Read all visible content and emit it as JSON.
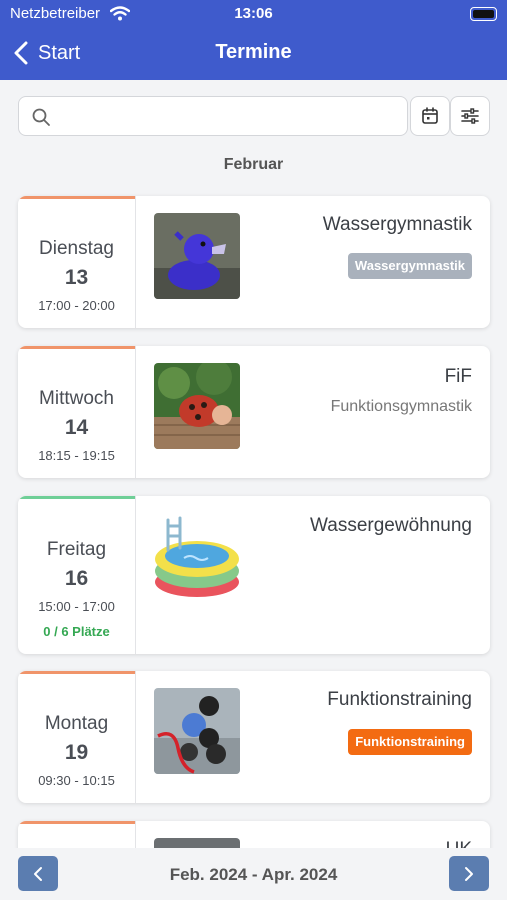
{
  "status_bar": {
    "carrier": "Netzbetreiber",
    "time": "13:06"
  },
  "nav": {
    "back_label": "Start",
    "title": "Termine"
  },
  "search": {
    "placeholder": "",
    "value": ""
  },
  "month_header": "Februar",
  "appointments": [
    {
      "weekday": "Dienstag",
      "day": "13",
      "time": "17:00 - 20:00",
      "title": "Wassergymnastik",
      "badge": "Wassergymnastik",
      "badge_color": "#a9b1bc",
      "accent": "#f0946a",
      "image": "purple-rubber-duck"
    },
    {
      "weekday": "Mittwoch",
      "day": "14",
      "time": "18:15 - 19:15",
      "title": "FiF",
      "subtitle": "Funktionsgymnastik",
      "accent": "#f0946a",
      "image": "ladybug-figure"
    },
    {
      "weekday": "Freitag",
      "day": "16",
      "time": "15:00 - 17:00",
      "slots": "0 / 6 Plätze",
      "title": "Wassergewöhnung",
      "accent": "#6fcf97",
      "image": "paddling-pool"
    },
    {
      "weekday": "Montag",
      "day": "19",
      "time": "09:30 - 10:15",
      "title": "Funktionstraining",
      "badge": "Funktionstraining",
      "badge_color": "#f36b12",
      "accent": "#f0946a",
      "image": "kettlebells"
    },
    {
      "title": "UK",
      "accent": "#f0946a"
    }
  ],
  "pagination": {
    "range": "Feb. 2024 - Apr. 2024"
  },
  "colors": {
    "brand": "#3f5bcc",
    "pager_button": "#5b7db0",
    "available_green": "#35a853"
  }
}
